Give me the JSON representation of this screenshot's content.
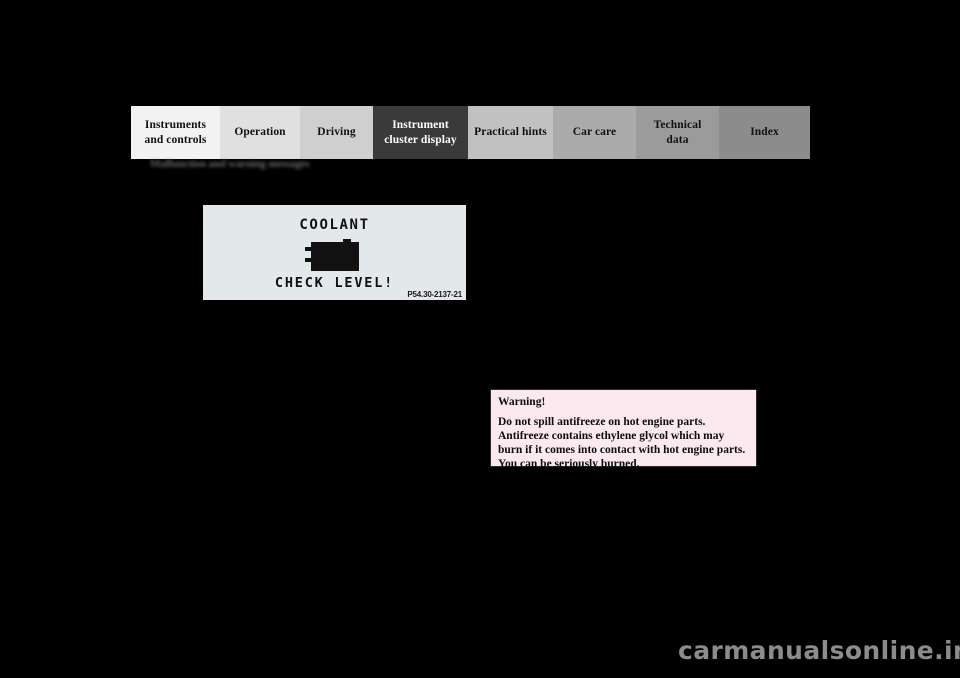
{
  "page": {
    "background_color": "#000000",
    "section_heading": "Malfunction and warning messages"
  },
  "tabbar": {
    "tabs": [
      {
        "label_line1": "Instruments",
        "label_line2": "and controls",
        "bg": "#f2f2f2",
        "active": false
      },
      {
        "label_line1": "Operation",
        "label_line2": "",
        "bg": "#e0e0e0",
        "active": false
      },
      {
        "label_line1": "Driving",
        "label_line2": "",
        "bg": "#cfcfcf",
        "active": false
      },
      {
        "label_line1": "Instrument",
        "label_line2": "cluster display",
        "bg": "#3a3a3a",
        "active": true
      },
      {
        "label_line1": "Practical hints",
        "label_line2": "",
        "bg": "#c1c1c1",
        "active": false
      },
      {
        "label_line1": "Car care",
        "label_line2": "",
        "bg": "#ababab",
        "active": false
      },
      {
        "label_line1": "Technical",
        "label_line2": "data",
        "bg": "#9b9b9b",
        "active": false
      },
      {
        "label_line1": "Index",
        "label_line2": "",
        "bg": "#8c8c8c",
        "active": false
      }
    ]
  },
  "figure": {
    "display_top_text": "COOLANT",
    "display_bottom_text": "CHECK LEVEL!",
    "icon_name": "coolant-reservoir-icon",
    "caption": "P54.30-2137-21",
    "background_color": "#e3e8eb"
  },
  "warning": {
    "title": "Warning!",
    "body": "Do not spill antifreeze on hot engine parts. Antifreeze contains ethylene glycol which may burn if it comes into contact with hot engine parts. You can be seriously burned.",
    "background_color": "#fce9f0",
    "border_color": "#2b2b2b"
  },
  "watermark": {
    "text": "carmanualsonline.info",
    "color": "#8c8c8c"
  }
}
